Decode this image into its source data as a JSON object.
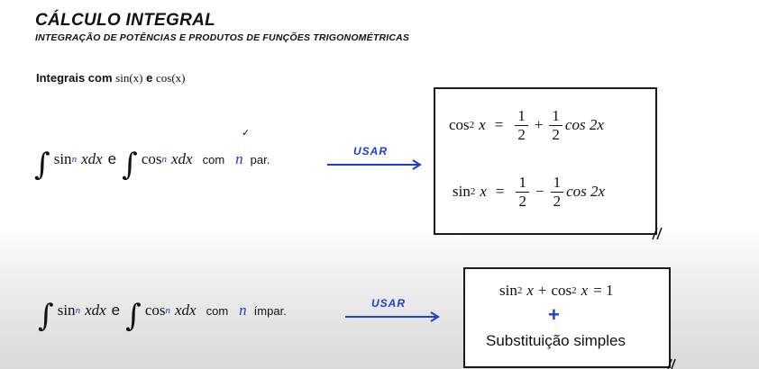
{
  "header": {
    "title": "CÁLCULO INTEGRAL",
    "subtitle": "INTEGRAÇÃO DE POTÊNCIAS E PRODUTOS DE FUNÇÕES TRIGONOMÉTRICAS"
  },
  "section": {
    "prefix": "Integrais com",
    "sin_x": "sin(x)",
    "and": "e",
    "cos_x": "cos(x)"
  },
  "case_even": {
    "integral": "∫",
    "sin": "sin",
    "n": "n",
    "xdx": "xdx",
    "and": "e",
    "cos": "cos",
    "com": "com",
    "par_label": "par.",
    "arrow_label": "USAR",
    "check": "✓"
  },
  "box_even": {
    "line1": {
      "lhs": "cos",
      "exp": "2",
      "var": "x",
      "eq": "=",
      "f1_num": "1",
      "f1_den": "2",
      "op": "+",
      "f2_num": "1",
      "f2_den": "2",
      "tail": "cos 2x"
    },
    "line2": {
      "lhs": "sin",
      "exp": "2",
      "var": "x",
      "eq": "=",
      "f1_num": "1",
      "f1_den": "2",
      "op": "−",
      "f2_num": "1",
      "f2_den": "2",
      "tail": "cos 2x"
    }
  },
  "case_odd": {
    "integral": "∫",
    "sin": "sin",
    "n": "n",
    "xdx": "xdx",
    "and": "e",
    "cos": "cos",
    "com": "com",
    "impar_label": "ímpar.",
    "arrow_label": "USAR"
  },
  "box_odd": {
    "sin": "sin",
    "exp1": "2",
    "x1": "x",
    "plus": "+",
    "cos": "cos",
    "exp2": "2",
    "x2": "x",
    "eq": "= 1",
    "plus_sign": "+",
    "text": "Substituição simples"
  },
  "colors": {
    "accent_blue": "#1a3fd1",
    "ink": "#111111"
  }
}
